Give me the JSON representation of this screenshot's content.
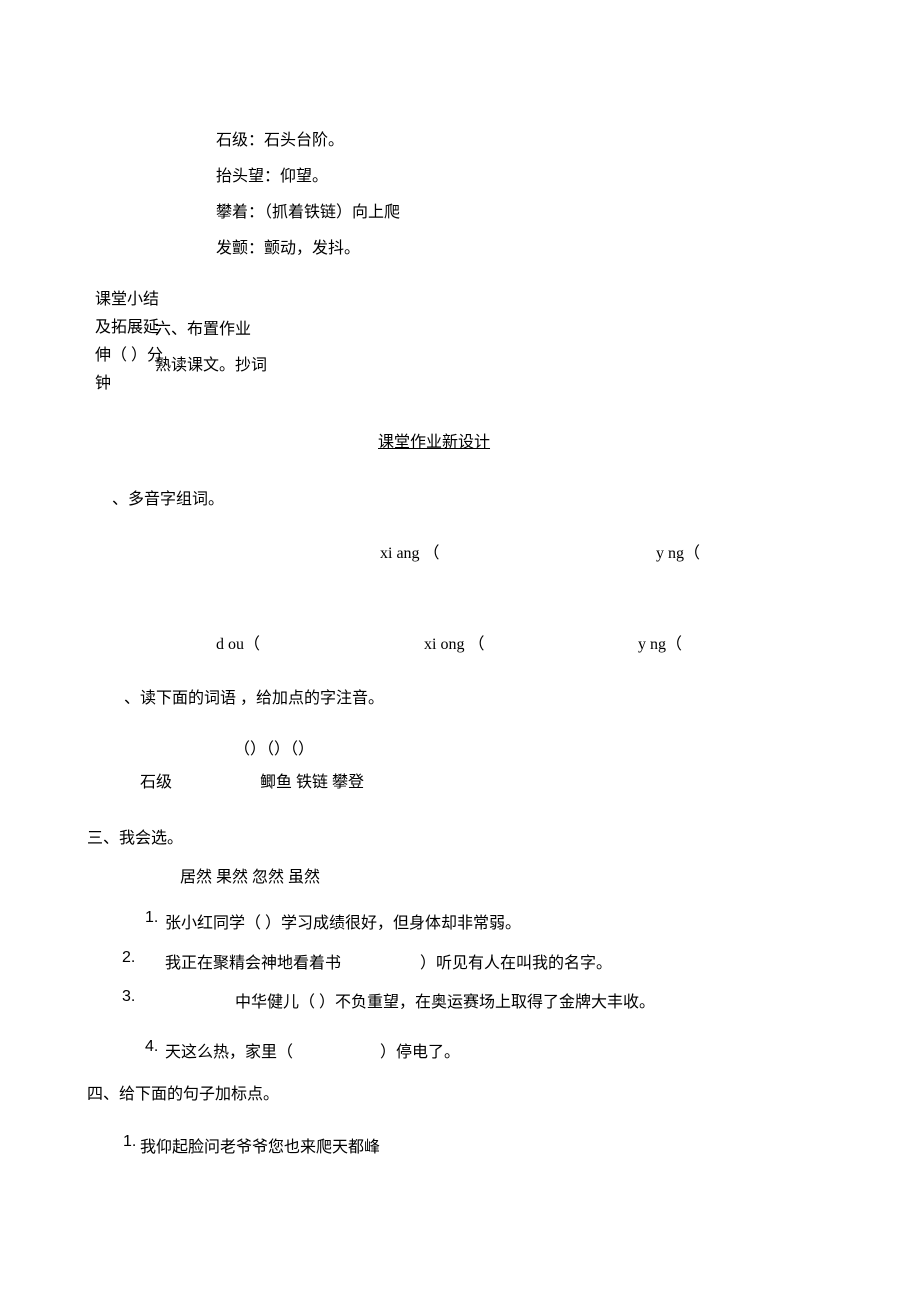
{
  "definitions": {
    "line1": "石级：石头台阶。",
    "line2": "抬头望：仰望。",
    "line3": "攀着：（抓着铁链）向上爬",
    "line4": "发颤：颤动，发抖。"
  },
  "summary": {
    "label_line1": "课堂小结",
    "label_line2": "及拓展延",
    "label_line3": "伸（  ）分",
    "label_line4": "钟",
    "assignment_title": "六、布置作业",
    "assignment_content": "熟读课文。抄词"
  },
  "worksheet_title": "课堂作业新设计",
  "section1": {
    "header": "、多音字组词。",
    "pinyin1": "xi ang   （",
    "pinyin2": "y ng（",
    "pinyin3": "d ou（",
    "pinyin4": "xi ong   （",
    "pinyin5": "y ng（"
  },
  "section2": {
    "header": "、读下面的词语   ，给加点的字注音。",
    "parens": "（）（）（）",
    "word1": "石级",
    "words_rest": "鲫鱼  铁链  攀登"
  },
  "section3": {
    "header": "三、我会选。",
    "choices": "居然      果然  忽然  虽然",
    "q1_num": "1.",
    "q1": "张小红同学（    ）学习成绩很好，但身体却非常弱。",
    "q2_num": "2.",
    "q2a": "我正在聚精会神地看着书",
    "q2b": "）听见有人在叫我的名字。",
    "q3_num": "3.",
    "q3": "中华健儿（   ）不负重望，在奥运赛场上取得了金牌大丰收。",
    "q4_num": "4.",
    "q4a": "天这么热，家里（",
    "q4b": "）停电了。"
  },
  "section4": {
    "header": "四、给下面的句子加标点。",
    "q1_num": "1.",
    "q1": "我仰起脸问老爷爷您也来爬天都峰"
  }
}
